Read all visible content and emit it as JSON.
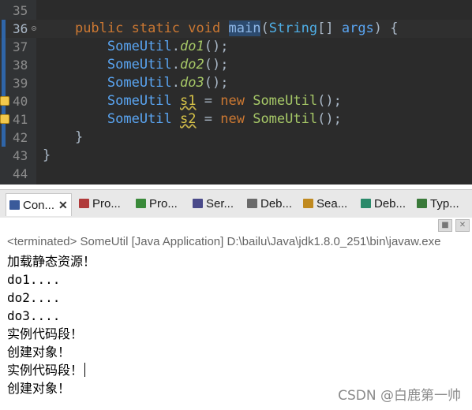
{
  "editor": {
    "lines": [
      {
        "num": "35",
        "segments": []
      },
      {
        "num": "36",
        "segments": [
          {
            "t": "    "
          },
          {
            "t": "public",
            "c": "kw"
          },
          {
            "t": " "
          },
          {
            "t": "static",
            "c": "kw"
          },
          {
            "t": " "
          },
          {
            "t": "void",
            "c": "kw"
          },
          {
            "t": " "
          },
          {
            "t": "main",
            "c": "sel"
          },
          {
            "t": "(",
            "c": "plain"
          },
          {
            "t": "String",
            "c": "str-cls"
          },
          {
            "t": "[] ",
            "c": "plain"
          },
          {
            "t": "args",
            "c": "cls"
          },
          {
            "t": ") {",
            "c": "plain"
          }
        ]
      },
      {
        "num": "37",
        "segments": [
          {
            "t": "        "
          },
          {
            "t": "SomeUtil",
            "c": "cls"
          },
          {
            "t": ".",
            "c": "plain"
          },
          {
            "t": "do1",
            "c": "mth"
          },
          {
            "t": "();",
            "c": "plain"
          }
        ]
      },
      {
        "num": "38",
        "segments": [
          {
            "t": "        "
          },
          {
            "t": "SomeUtil",
            "c": "cls"
          },
          {
            "t": ".",
            "c": "plain"
          },
          {
            "t": "do2",
            "c": "mth"
          },
          {
            "t": "();",
            "c": "plain"
          }
        ]
      },
      {
        "num": "39",
        "segments": [
          {
            "t": "        "
          },
          {
            "t": "SomeUtil",
            "c": "cls"
          },
          {
            "t": ".",
            "c": "plain"
          },
          {
            "t": "do3",
            "c": "mth"
          },
          {
            "t": "();",
            "c": "plain"
          }
        ]
      },
      {
        "num": "40",
        "segments": [
          {
            "t": "        "
          },
          {
            "t": "SomeUtil",
            "c": "cls"
          },
          {
            "t": " "
          },
          {
            "t": "s1",
            "c": "var"
          },
          {
            "t": " = ",
            "c": "plain"
          },
          {
            "t": "new",
            "c": "kw"
          },
          {
            "t": " "
          },
          {
            "t": "SomeUtil",
            "c": "ctor"
          },
          {
            "t": "();",
            "c": "plain"
          }
        ]
      },
      {
        "num": "41",
        "segments": [
          {
            "t": "        "
          },
          {
            "t": "SomeUtil",
            "c": "cls"
          },
          {
            "t": " "
          },
          {
            "t": "s2",
            "c": "var"
          },
          {
            "t": " = ",
            "c": "plain"
          },
          {
            "t": "new",
            "c": "kw"
          },
          {
            "t": " "
          },
          {
            "t": "SomeUtil",
            "c": "ctor"
          },
          {
            "t": "();",
            "c": "plain"
          }
        ]
      },
      {
        "num": "42",
        "segments": [
          {
            "t": "    "
          },
          {
            "t": "}",
            "c": "plain"
          }
        ]
      },
      {
        "num": "43",
        "segments": [
          {
            "t": "}",
            "c": "plain"
          }
        ]
      },
      {
        "num": "44",
        "segments": []
      }
    ]
  },
  "tabs": [
    {
      "label": "Con...",
      "icon": "console-icon",
      "color": "#3a5a9a",
      "active": true,
      "close": "✕"
    },
    {
      "label": "Pro...",
      "icon": "problems-icon",
      "color": "#b03a3a"
    },
    {
      "label": "Pro...",
      "icon": "progress-icon",
      "color": "#3a8a3a"
    },
    {
      "label": "Ser...",
      "icon": "servers-icon",
      "color": "#4a4a8a"
    },
    {
      "label": "Deb...",
      "icon": "debug-icon",
      "color": "#6a6a6a"
    },
    {
      "label": "Sea...",
      "icon": "search-icon",
      "color": "#c08a20"
    },
    {
      "label": "Deb...",
      "icon": "debug-shell-icon",
      "color": "#2a8a6a"
    },
    {
      "label": "Typ...",
      "icon": "type-hierarchy-icon",
      "color": "#3a7a3a"
    }
  ],
  "console": {
    "header": "<terminated> SomeUtil [Java Application] D:\\bailu\\Java\\jdk1.8.0_251\\bin\\javaw.exe",
    "output": [
      "加载静态资源！",
      "do1....",
      "do2....",
      "do3....",
      "实例代码段！",
      "创建对象！",
      "实例代码段！",
      "创建对象！"
    ]
  },
  "watermark": "CSDN @白鹿第一帅"
}
